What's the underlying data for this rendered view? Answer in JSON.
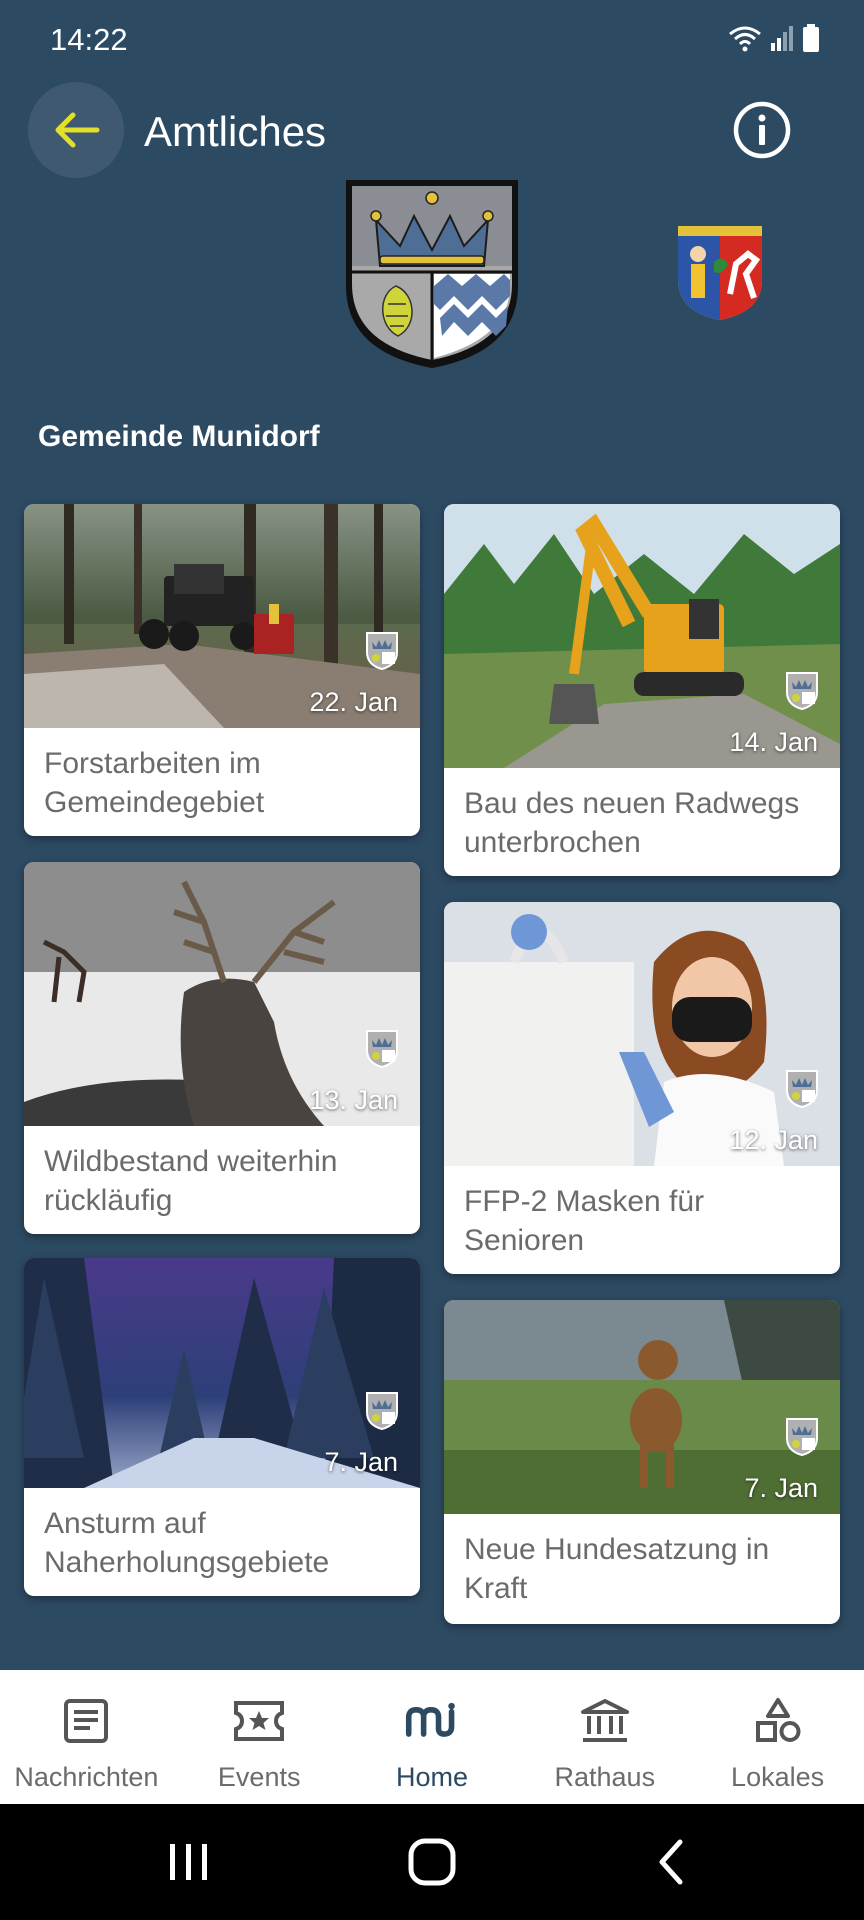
{
  "status": {
    "time": "14:22"
  },
  "appbar": {
    "title": "Amtliches"
  },
  "section": {
    "title": "Gemeinde Munidorf"
  },
  "cards": [
    {
      "title": "Forstarbeiten im Gemeindegebiet",
      "date": "22. Jan",
      "image": "forestry-machine"
    },
    {
      "title": "Bau des neuen Radwegs unterbrochen",
      "date": "14. Jan",
      "image": "excavator"
    },
    {
      "title": "Wildbestand weiterhin rückläufig",
      "date": "13. Jan",
      "image": "deer-in-snow"
    },
    {
      "title": "FFP-2 Masken für Senioren",
      "date": "12. Jan",
      "image": "woman-with-mask"
    },
    {
      "title": "Ansturm auf Naherholungsgebiete",
      "date": "7. Jan",
      "image": "snowy-forest-road"
    },
    {
      "title": "Neue Hundesatzung in Kraft",
      "date": "7. Jan",
      "image": "dog-on-field"
    }
  ],
  "nav": {
    "items": [
      {
        "label": "Nachrichten",
        "icon": "newspaper-icon"
      },
      {
        "label": "Events",
        "icon": "ticket-star-icon"
      },
      {
        "label": "Home",
        "icon": "home-logo-icon"
      },
      {
        "label": "Rathaus",
        "icon": "town-hall-icon"
      },
      {
        "label": "Lokales",
        "icon": "shapes-icon"
      }
    ],
    "active": "Home"
  },
  "colors": {
    "background": "#2d4a63",
    "accent": "#e3e02c",
    "nav_active": "#2d4a63"
  }
}
